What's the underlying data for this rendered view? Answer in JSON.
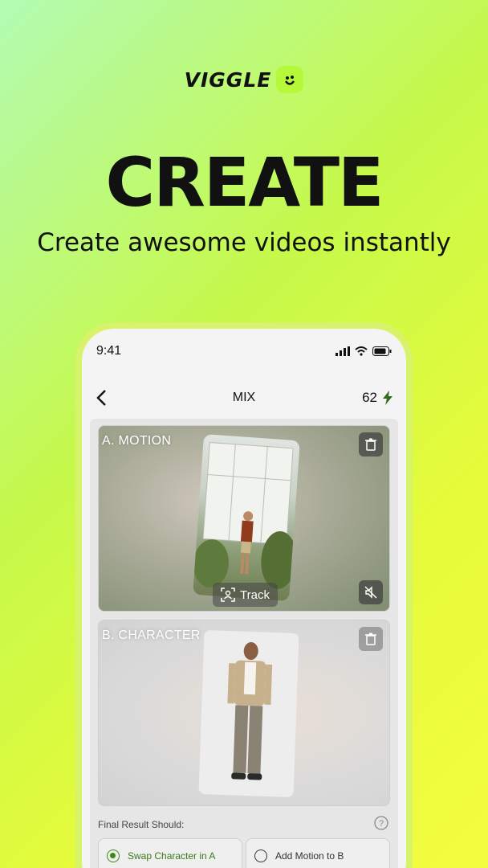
{
  "brand": {
    "logo_text": "VIGGLE"
  },
  "hero": {
    "headline": "CREATE",
    "subline": "Create awesome videos instantly"
  },
  "phone": {
    "status_time": "9:41",
    "nav": {
      "title": "MIX",
      "credits": "62"
    },
    "card_a": {
      "label": "A. MOTION",
      "track_label": "Track"
    },
    "card_b": {
      "label": "B. CHARACTER"
    },
    "final_result": {
      "label": "Final Result Should:",
      "options": [
        {
          "label": "Swap Character in A",
          "selected": true
        },
        {
          "label": "Add Motion to B",
          "selected": false
        }
      ]
    }
  },
  "colors": {
    "accent": "#c6f94a",
    "selected": "#3a8a1a"
  }
}
